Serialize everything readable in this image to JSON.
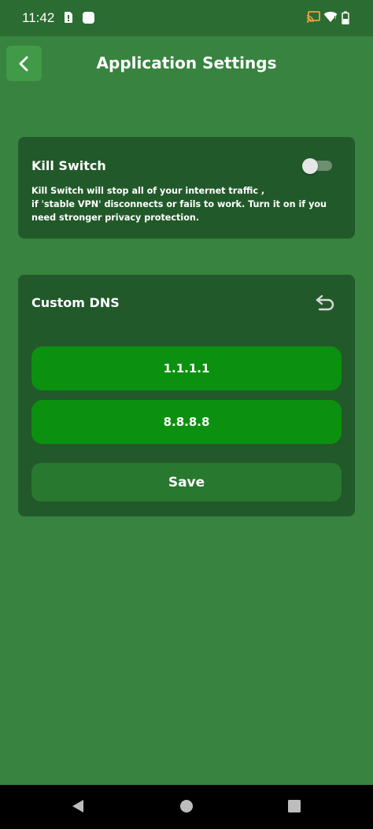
{
  "status_bar": {
    "time": "11:42"
  },
  "header": {
    "title": "Application Settings"
  },
  "kill_switch": {
    "title": "Kill Switch",
    "description": "Kill Switch will stop all of your internet traffic ,\nif 'stable VPN' disconnects or fails to work. Turn it on if you\nneed stronger privacy protection.",
    "enabled": false
  },
  "custom_dns": {
    "title": "Custom DNS",
    "primary_dns": "1.1.1.1",
    "secondary_dns": "8.8.8.8",
    "save_label": "Save"
  },
  "colors": {
    "background": "#37833f",
    "card": "#22592a",
    "field": "#0c900f",
    "save_button": "#287830"
  }
}
